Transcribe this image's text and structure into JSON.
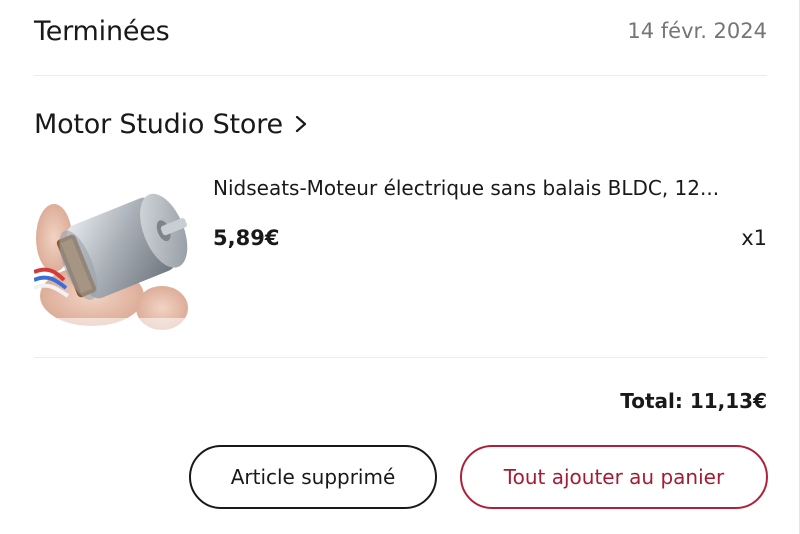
{
  "order": {
    "status": "Terminées",
    "date": "14 févr. 2024"
  },
  "store": {
    "name": "Motor Studio Store",
    "chevron_icon": "chevron-right-icon"
  },
  "product": {
    "title": "Nidseats-Moteur électrique sans balais BLDC, 12...",
    "price": "5,89€",
    "quantity": "x1",
    "image_icon": "bldc-motor-photo"
  },
  "total": "Total: 11,13€",
  "actions": {
    "removed_label": "Article supprimé",
    "add_all_label": "Tout ajouter au panier"
  },
  "colors": {
    "accent": "#a31c34",
    "text": "#191919",
    "muted": "#757575"
  }
}
